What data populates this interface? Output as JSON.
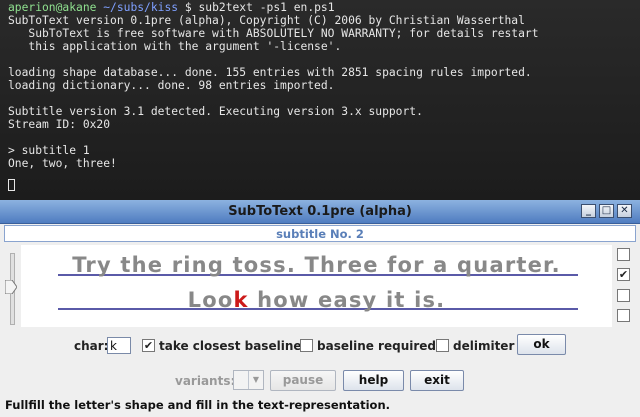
{
  "terminal": {
    "user": "aperion@akane",
    "path": "~/subs/kiss",
    "prompt": "$",
    "command": "sub2text -ps1 en.ps1",
    "lines": [
      "SubToText version 0.1pre (alpha), Copyright (C) 2006 by Christian Wasserthal",
      "   SubToText is free software with ABSOLUTELY NO WARRANTY; for details restart",
      "   this application with the argument '-license'.",
      "",
      "loading shape database... done. 155 entries with 2851 spacing rules imported.",
      "loading dictionary... done. 98 entries imported.",
      "",
      "Subtitle version 3.1 detected. Executing version 3.x support.",
      "Stream ID: 0x20",
      "",
      "> subtitle 1",
      "One, two, three!"
    ]
  },
  "window": {
    "title": "SubToText 0.1pre (alpha)",
    "buttons": {
      "minimize": "_",
      "maximize": "□",
      "close": "✕"
    },
    "subtitle_no": "subtitle No. 2",
    "subtitle_lines": {
      "line1": "Try the ring toss. Three for a quarter.",
      "line2_before": "Loo",
      "line2_highlight": "k",
      "line2_after": " how easy it is."
    },
    "right_checkboxes": [
      false,
      true,
      false,
      false
    ],
    "controls": {
      "char_label": "char:",
      "char_value": "k",
      "take_closest_baseline_label": "take closest baseline",
      "take_closest_baseline_checked": true,
      "baseline_required_label": "baseline required",
      "baseline_required_checked": false,
      "delimiter_label": "delimiter",
      "delimiter_checked": false,
      "ok_label": "ok",
      "variants_label": "variants:",
      "pause_label": "pause",
      "help_label": "help",
      "exit_label": "exit"
    },
    "status": "Fullfill the letter's shape and fill in the text-representation."
  },
  "colors": {
    "highlight_letter": "#cc1a1a",
    "subtitle_text": "#888888",
    "baseline": "#5a5aa8",
    "titlebar": "#6a94d0"
  }
}
